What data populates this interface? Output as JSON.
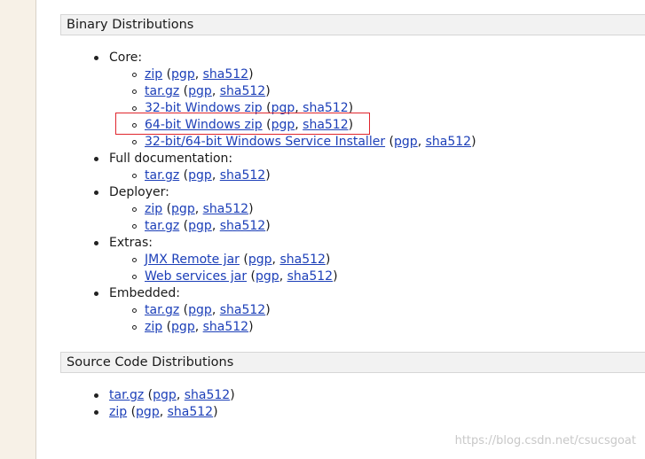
{
  "binary": {
    "header": "Binary Distributions",
    "groups": [
      {
        "label": "Core:",
        "items": [
          {
            "link": "zip",
            "pgp": "pgp",
            "sha": "sha512"
          },
          {
            "link": "tar.gz",
            "pgp": "pgp",
            "sha": "sha512"
          },
          {
            "link": "32-bit Windows zip",
            "pgp": "pgp",
            "sha": "sha512"
          },
          {
            "link": "64-bit Windows zip",
            "pgp": "pgp",
            "sha": "sha512"
          },
          {
            "link": "32-bit/64-bit Windows Service Installer",
            "pgp": "pgp",
            "sha": "sha512"
          }
        ]
      },
      {
        "label": "Full documentation:",
        "items": [
          {
            "link": "tar.gz",
            "pgp": "pgp",
            "sha": "sha512"
          }
        ]
      },
      {
        "label": "Deployer:",
        "items": [
          {
            "link": "zip",
            "pgp": "pgp",
            "sha": "sha512"
          },
          {
            "link": "tar.gz",
            "pgp": "pgp",
            "sha": "sha512"
          }
        ]
      },
      {
        "label": "Extras:",
        "items": [
          {
            "link": "JMX Remote jar",
            "pgp": "pgp",
            "sha": "sha512"
          },
          {
            "link": "Web services jar",
            "pgp": "pgp",
            "sha": "sha512"
          }
        ]
      },
      {
        "label": "Embedded:",
        "items": [
          {
            "link": "tar.gz",
            "pgp": "pgp",
            "sha": "sha512"
          },
          {
            "link": "zip",
            "pgp": "pgp",
            "sha": "sha512"
          }
        ]
      }
    ]
  },
  "source": {
    "header": "Source Code Distributions",
    "items": [
      {
        "link": "tar.gz",
        "pgp": "pgp",
        "sha": "sha512"
      },
      {
        "link": "zip",
        "pgp": "pgp",
        "sha": "sha512"
      }
    ]
  },
  "punct": {
    "open": " (",
    "comma": ", ",
    "close": ")"
  },
  "watermark": "https://blog.csdn.net/csucsgoat",
  "colors": {
    "link": "#1c3fb8",
    "highlight": "#e0262d",
    "header_bg": "#f2f2f2",
    "sidebar_bg": "#f7f1e7"
  }
}
